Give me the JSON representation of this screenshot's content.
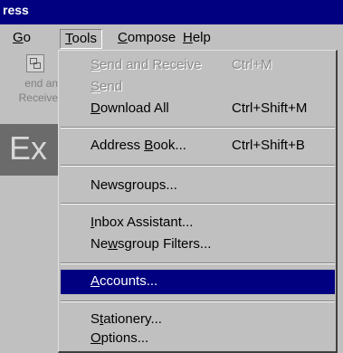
{
  "window": {
    "title_fragment": "ress"
  },
  "menubar": {
    "items": [
      {
        "pre": "",
        "u": "G",
        "post": "o"
      },
      {
        "pre": "",
        "u": "T",
        "post": "ools"
      },
      {
        "pre": "",
        "u": "C",
        "post": "ompose"
      },
      {
        "pre": "",
        "u": "H",
        "post": "elp"
      }
    ]
  },
  "toolbar": {
    "label_line1": "end an",
    "label_line2": "Receive",
    "banner_text": "Ex"
  },
  "tools_menu": {
    "items": [
      {
        "pre": "",
        "u": "S",
        "post": "end and Receive",
        "shortcut": "Ctrl+M"
      },
      {
        "pre": "",
        "u": "S",
        "post": "end",
        "shortcut": ""
      },
      {
        "pre": "",
        "u": "D",
        "post": "ownload All",
        "shortcut": "Ctrl+Shift+M"
      },
      {
        "pre": "Address ",
        "u": "B",
        "post": "ook...",
        "shortcut": "Ctrl+Shift+B"
      },
      {
        "pre": "News",
        "u": "g",
        "post": "roups...",
        "shortcut": ""
      },
      {
        "pre": "",
        "u": "I",
        "post": "nbox Assistant...",
        "shortcut": ""
      },
      {
        "pre": "Ne",
        "u": "w",
        "post": "sgroup Filters...",
        "shortcut": ""
      },
      {
        "pre": "",
        "u": "A",
        "post": "ccounts...",
        "shortcut": ""
      },
      {
        "pre": "S",
        "u": "t",
        "post": "ationery...",
        "shortcut": ""
      },
      {
        "pre": "",
        "u": "O",
        "post": "ptions...",
        "shortcut": ""
      }
    ]
  }
}
